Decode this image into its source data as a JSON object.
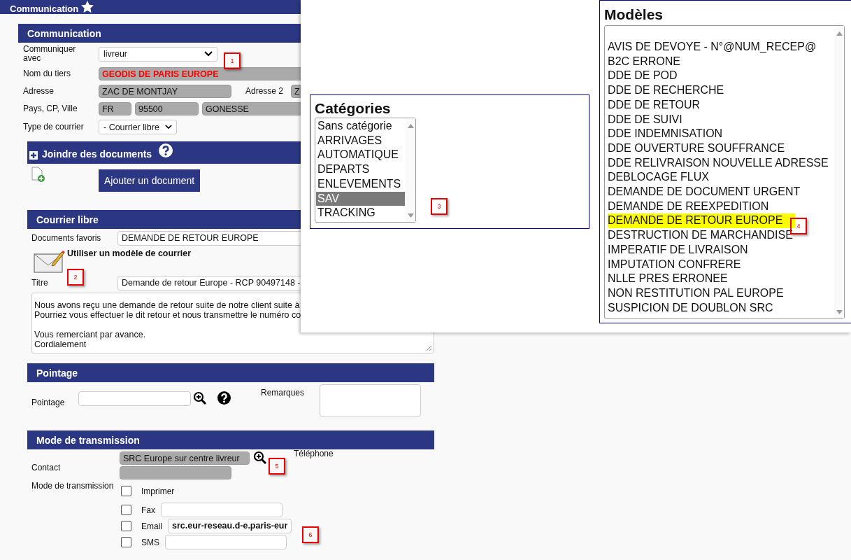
{
  "page_header": {
    "title": "Communication"
  },
  "communication": {
    "title": "Communication",
    "communiquer_avec": {
      "label": "Communiquer avec",
      "value": "livreur"
    },
    "nom_du_tiers": {
      "label": "Nom du tiers",
      "value": "GEODIS DE PARIS EUROPE"
    },
    "adresse": {
      "label": "Adresse",
      "value": "ZAC DE MONTJAY"
    },
    "adresse_2": {
      "label": "Adresse 2",
      "value": "Z"
    },
    "pays_cp_ville": {
      "label": "Pays, CP, Ville",
      "values": [
        "FR",
        "95500",
        "GONESSE"
      ]
    },
    "type_de_courrier": {
      "label": "Type de courrier",
      "value": "- Courrier libre"
    }
  },
  "attachments": {
    "title": "Joindre des documents",
    "button": "Ajouter un document"
  },
  "courrier_libre": {
    "title": "Courrier libre",
    "documents_favoris": {
      "label": "Documents favoris",
      "value": "DEMANDE DE RETOUR EUROPE"
    },
    "template_link": "Utiliser un modèle de courrier",
    "titre": {
      "label": "Titre",
      "value": "Demande de retour Europe - RCP 90497148 -"
    },
    "body": [
      [
        "Nous avons reçu une demande de retour suite de notre client suite à",
        "Pourriez vous effectuer le dit retour et nous transmettre le numéro co"
      ],
      [
        "Vous remerciant par avance.",
        "Cordialement"
      ]
    ]
  },
  "pointage": {
    "title": "Pointage",
    "field_label": "Pointage",
    "remarques_label": "Remarques"
  },
  "transmission": {
    "title": "Mode de transmission",
    "contact": {
      "label": "Contact",
      "value": "SRC Europe sur centre livreur"
    },
    "telephone_label": "Téléphone",
    "mode_label": "Mode de transmission",
    "options": [
      {
        "label": "Imprimer",
        "checked": false,
        "kind": "plain"
      },
      {
        "label": "Fax",
        "checked": false,
        "kind": "field"
      },
      {
        "label": "Email",
        "checked": false,
        "kind": "field",
        "value": "src.eur-reseau.d-e.paris-eur"
      },
      {
        "label": "SMS",
        "checked": false,
        "kind": "field"
      }
    ]
  },
  "categories": {
    "title": "Catégories",
    "items": [
      {
        "label": "Sans catégorie",
        "selected": false
      },
      {
        "label": "ARRIVAGES",
        "selected": false
      },
      {
        "label": "AUTOMATIQUE",
        "selected": false
      },
      {
        "label": "DEPARTS",
        "selected": false
      },
      {
        "label": "ENLEVEMENTS",
        "selected": false
      },
      {
        "label": "SAV",
        "selected": true
      },
      {
        "label": "TRACKING",
        "selected": false
      }
    ]
  },
  "modeles": {
    "title": "Modèles",
    "items": [
      {
        "label": "AVIS DE DEVOYE - N°@NUM_RECEP@",
        "selected": false
      },
      {
        "label": "B2C ERRONE",
        "selected": false
      },
      {
        "label": "DDE DE POD",
        "selected": false
      },
      {
        "label": "DDE DE RECHERCHE",
        "selected": false
      },
      {
        "label": "DDE DE RETOUR",
        "selected": false
      },
      {
        "label": "DDE DE SUIVI",
        "selected": false
      },
      {
        "label": "DDE INDEMNISATION",
        "selected": false
      },
      {
        "label": "DDE OUVERTURE SOUFFRANCE",
        "selected": false
      },
      {
        "label": "DDE RELIVRAISON NOUVELLE ADRESSE",
        "selected": false
      },
      {
        "label": "DEBLOCAGE FLUX",
        "selected": false
      },
      {
        "label": "DEMANDE DE DOCUMENT URGENT",
        "selected": false
      },
      {
        "label": "DEMANDE DE REEXPEDITION",
        "selected": false
      },
      {
        "label": "DEMANDE DE RETOUR EUROPE",
        "selected": true
      },
      {
        "label": "DESTRUCTION DE MARCHANDISE",
        "selected": false
      },
      {
        "label": "IMPERATIF DE LIVRAISON",
        "selected": false
      },
      {
        "label": "IMPUTATION CONFRERE",
        "selected": false
      },
      {
        "label": "NLLE PRES ERRONEE",
        "selected": false
      },
      {
        "label": "NON RESTITUTION PAL EUROPE",
        "selected": false
      },
      {
        "label": "SUSPICION DE DOUBLON SRC",
        "selected": false
      }
    ]
  },
  "callouts": [
    "1",
    "2",
    "3",
    "4",
    "5",
    "6"
  ]
}
